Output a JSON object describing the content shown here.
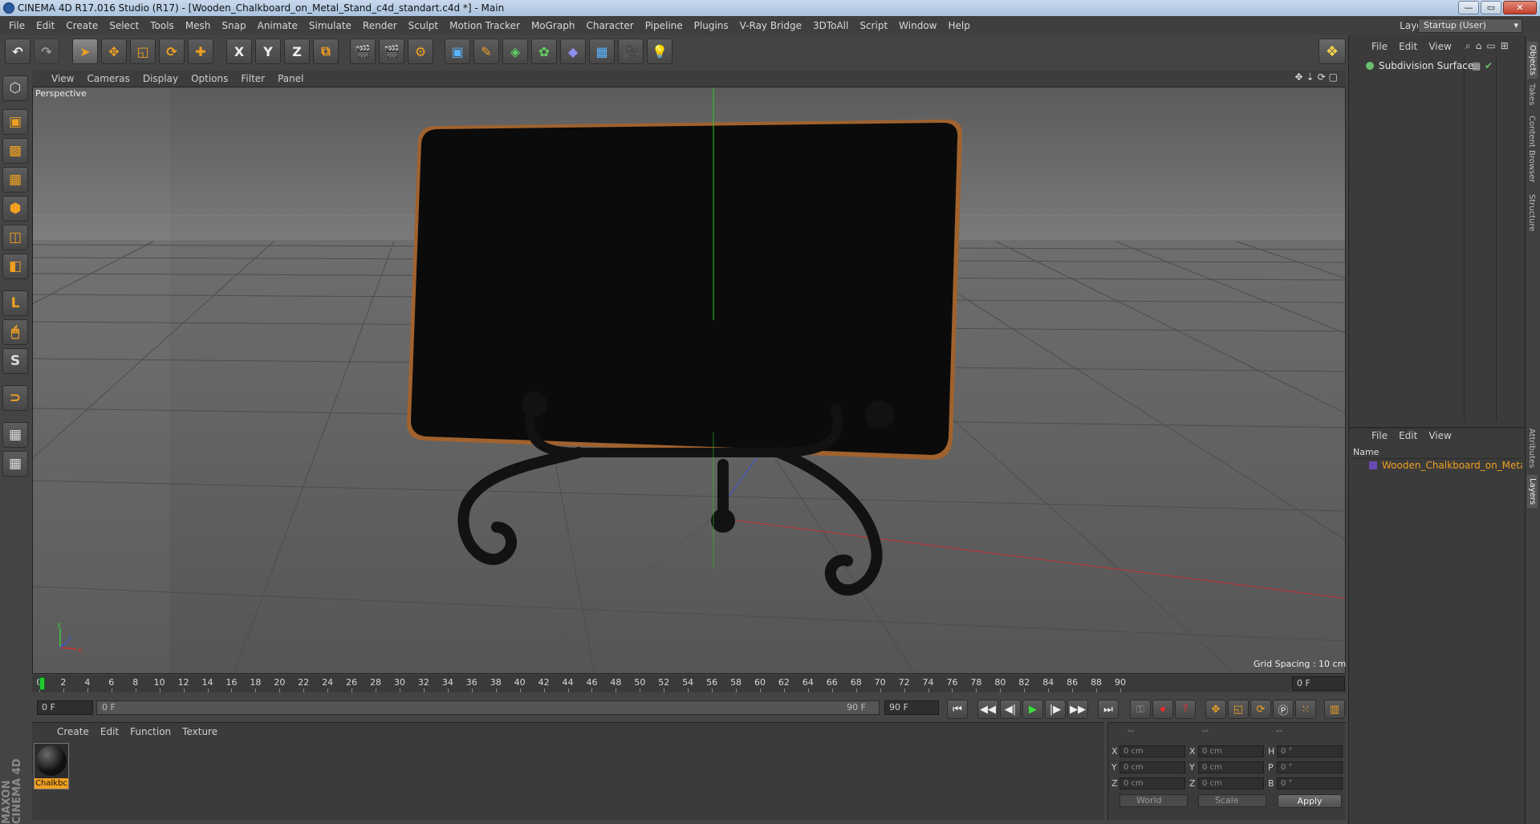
{
  "window": {
    "title": "CINEMA 4D R17.016 Studio (R17) - [Wooden_Chalkboard_on_Metal_Stand_c4d_standart.c4d *] - Main",
    "controls": {
      "minimize": "—",
      "maximize": "▭",
      "close": "✕"
    }
  },
  "menu": [
    "File",
    "Edit",
    "Create",
    "Select",
    "Tools",
    "Mesh",
    "Snap",
    "Animate",
    "Simulate",
    "Render",
    "Sculpt",
    "Motion Tracker",
    "MoGraph",
    "Character",
    "Pipeline",
    "Plugins",
    "V-Ray Bridge",
    "3DToAll",
    "Script",
    "Window",
    "Help"
  ],
  "layout": {
    "label": "Layout:",
    "value": "Startup (User)"
  },
  "toolbar": {
    "undo": "↶",
    "redo": "↷",
    "live_select": "➤",
    "move": "✥",
    "scale": "◱",
    "rotate": "⟳",
    "recent_tool": "✚",
    "x_axis": "X",
    "y_axis": "Y",
    "z_axis": "Z",
    "coord_system": "⧉",
    "render_view": "🎬",
    "render_picture": "🎬",
    "render_settings": "⚙",
    "cube": "▣",
    "pen": "✎",
    "subdivision": "◈",
    "array": "✿",
    "deformer": "◆",
    "floor": "▦",
    "camera": "🎥",
    "light": "💡"
  },
  "left_tools": [
    "⬡",
    "▣",
    "▩",
    "▦",
    "⬢",
    "◫",
    "◧",
    "L",
    "🖱",
    "S",
    "⊃",
    "▦",
    "▦"
  ],
  "viewport": {
    "menu": [
      "View",
      "Cameras",
      "Display",
      "Options",
      "Filter",
      "Panel"
    ],
    "nav_icons": [
      "✥",
      "⇣",
      "⟳",
      "▢"
    ],
    "label": "Perspective",
    "grid_spacing": "Grid Spacing : 10 cm",
    "axis": {
      "x": "x",
      "y": "y",
      "z": "z"
    }
  },
  "timeline": {
    "ticks": [
      "0",
      "2",
      "4",
      "6",
      "8",
      "10",
      "12",
      "14",
      "16",
      "18",
      "20",
      "22",
      "24",
      "26",
      "28",
      "30",
      "32",
      "34",
      "36",
      "38",
      "40",
      "42",
      "44",
      "46",
      "48",
      "50",
      "52",
      "54",
      "56",
      "58",
      "60",
      "62",
      "64",
      "66",
      "68",
      "70",
      "72",
      "74",
      "76",
      "78",
      "80",
      "82",
      "84",
      "86",
      "88",
      "90"
    ],
    "current_frame": "0 F",
    "start_frame": "0 F",
    "scrub_start": "0 F",
    "scrub_end": "90 F",
    "end_frame": "90 F",
    "transport": [
      "⏮",
      "◀◀",
      "◀|",
      "▶",
      "|▶",
      "▶▶",
      "⏭"
    ]
  },
  "material_manager": {
    "menu": [
      "Create",
      "Edit",
      "Function",
      "Texture"
    ],
    "materials": [
      {
        "name": "Chalkbc"
      }
    ]
  },
  "coordinates": {
    "headers": [
      "--",
      "--",
      "--"
    ],
    "rows": [
      {
        "pos_label": "X",
        "pos": "0 cm",
        "size_label": "X",
        "size": "0 cm",
        "rot_label": "H",
        "rot": "0 °"
      },
      {
        "pos_label": "Y",
        "pos": "0 cm",
        "size_label": "Y",
        "size": "0 cm",
        "rot_label": "P",
        "rot": "0 °"
      },
      {
        "pos_label": "Z",
        "pos": "0 cm",
        "size_label": "Z",
        "size": "0 cm",
        "rot_label": "B",
        "rot": "0 °"
      }
    ],
    "mode_world": "World",
    "mode_scale": "Scale",
    "apply": "Apply"
  },
  "object_manager": {
    "menu": [
      "File",
      "Edit",
      "View"
    ],
    "objects": [
      {
        "name": "Subdivision Surface"
      }
    ]
  },
  "layers": {
    "menu": [
      "File",
      "Edit",
      "View"
    ],
    "column": "Name",
    "items": [
      {
        "name": "Wooden_Chalkboard_on_Metal_S"
      }
    ]
  },
  "side_tabs": [
    "Objects",
    "Takes",
    "Content Browser",
    "Structure",
    "Attributes",
    "Layers"
  ],
  "branding": "MAXON CINEMA 4D",
  "colors": {
    "accent": "#f0a020",
    "x_axis": "#d03030",
    "y_axis": "#30c030",
    "z_axis": "#3050d0"
  }
}
